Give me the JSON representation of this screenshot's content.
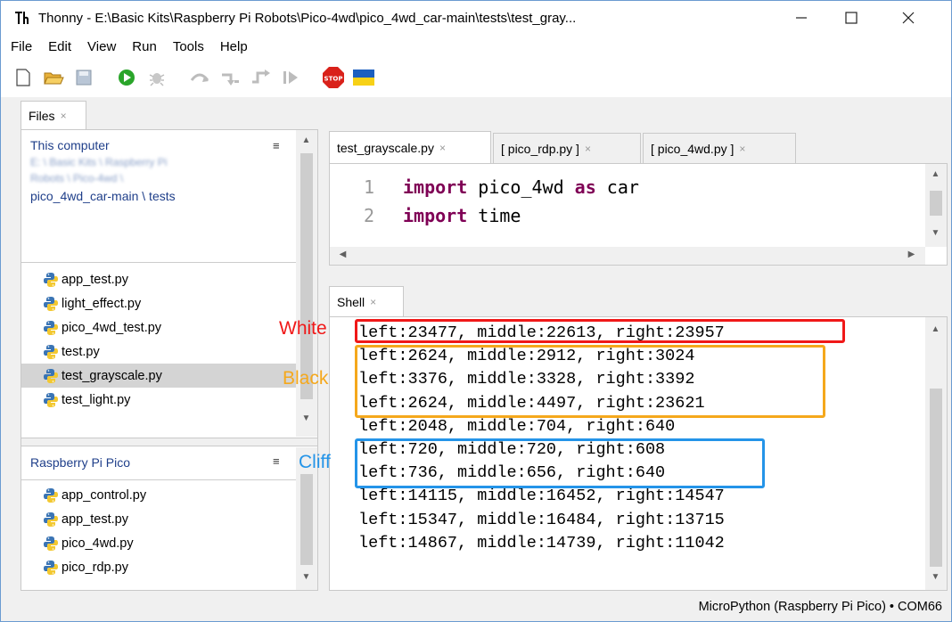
{
  "window": {
    "title": "Thonny  -  E:\\Basic Kits\\Raspberry Pi Robots\\Pico-4wd\\pico_4wd_car-main\\tests\\test_gray...",
    "min": "—",
    "max": "☐",
    "close": "✕"
  },
  "menu": [
    "File",
    "Edit",
    "View",
    "Run",
    "Tools",
    "Help"
  ],
  "toolbar": {
    "icons": [
      "new-file-icon",
      "open-folder-icon",
      "save-icon",
      "run-icon",
      "debug-icon",
      "step-over-icon",
      "step-into-icon",
      "step-out-icon",
      "resume-icon",
      "stop-icon",
      "ukraine-flag-icon"
    ]
  },
  "files": {
    "tab_label": "Files",
    "tab_close": "×",
    "this_computer": "This computer",
    "blurred_path_1": "E: \\ Basic Kits \\ Raspberry Pi",
    "blurred_path_2": "Robots \\ Pico-4wd \\",
    "path_visible": "pico_4wd_car-main \\ tests",
    "menu_icon": "≡",
    "computer_files": [
      "app_test.py",
      "light_effect.py",
      "pico_4wd_test.py",
      "test.py",
      "test_grayscale.py",
      "test_light.py"
    ],
    "selected_index": 4,
    "pico_header": "Raspberry Pi Pico",
    "pico_files": [
      "app_control.py",
      "app_test.py",
      "pico_4wd.py",
      "pico_rdp.py"
    ]
  },
  "editor": {
    "tabs": [
      {
        "label": "test_grayscale.py",
        "close": "×"
      },
      {
        "label": "[ pico_rdp.py ]",
        "close": "×"
      },
      {
        "label": "[ pico_4wd.py ]",
        "close": "×"
      }
    ],
    "lines": [
      {
        "num": "1",
        "kw1": "import",
        "rest1": " pico_4wd ",
        "kw2": "as",
        "rest2": " car"
      },
      {
        "num": "2",
        "kw1": "import",
        "rest1": " time",
        "kw2": "",
        "rest2": ""
      }
    ]
  },
  "shell": {
    "tab_label": "Shell",
    "tab_close": "×",
    "lines": [
      "left:23477, middle:22613, right:23957",
      "left:2624, middle:2912, right:3024",
      "left:3376, middle:3328, right:3392",
      "left:2624, middle:4497, right:23621",
      "left:2048, middle:704, right:640",
      "left:720, middle:720, right:608",
      "left:736, middle:656, right:640",
      "left:14115, middle:16452, right:14547",
      "left:15347, middle:16484, right:13715",
      "left:14867, middle:14739, right:11042"
    ]
  },
  "annotations": {
    "white": {
      "label": "White",
      "color": "#f01818"
    },
    "black": {
      "label": "Black",
      "color": "#f5a81c"
    },
    "cliff": {
      "label": "Cliff",
      "color": "#2494e8"
    }
  },
  "status": {
    "text": "MicroPython (Raspberry Pi Pico)  •  COM66"
  }
}
